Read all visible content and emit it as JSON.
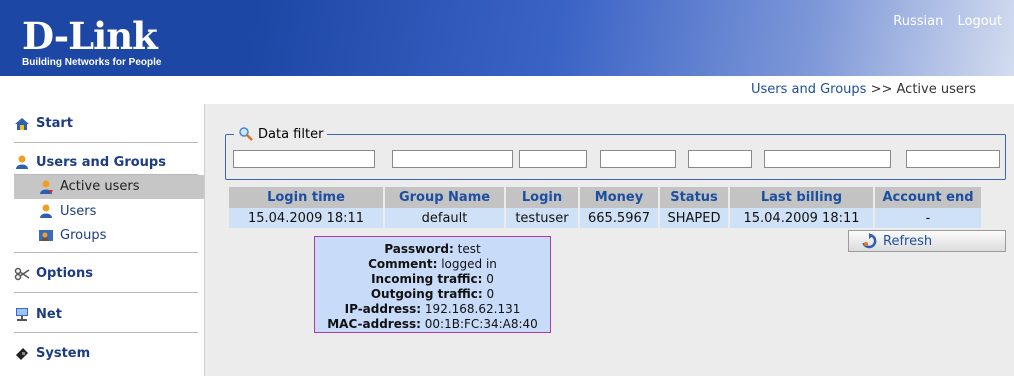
{
  "header": {
    "logo_text": "D-Link",
    "logo_tagline": "Building Networks for People",
    "links": [
      "Russian",
      "Logout"
    ]
  },
  "breadcrumb": {
    "section": "Users and Groups",
    "separator": ">>",
    "page": "Active users"
  },
  "sidebar": {
    "start": "Start",
    "users_groups": "Users and Groups",
    "sub_items": [
      "Active users",
      "Users",
      "Groups"
    ],
    "options": "Options",
    "net": "Net",
    "system": "System"
  },
  "filter": {
    "legend": "Data filter"
  },
  "table": {
    "columns": [
      "Login time",
      "Group Name",
      "Login",
      "Money",
      "Status",
      "Last billing",
      "Account end"
    ],
    "rows": [
      [
        "15.04.2009 18:11",
        "default",
        "testuser",
        "665.5967",
        "SHAPED",
        "15.04.2009 18:11",
        "-"
      ]
    ]
  },
  "refresh_label": "Refresh",
  "tooltip": {
    "password_label": "Password:",
    "password": "test",
    "comment_label": "Comment:",
    "comment": "logged in",
    "incoming_label": "Incoming traffic:",
    "incoming": "0",
    "outgoing_label": "Outgoing traffic:",
    "outgoing": "0",
    "ip_label": "IP-address:",
    "ip": "192.168.62.131",
    "mac_label": "MAC-address:",
    "mac": "00:1B:FC:34:A8:40"
  },
  "colors": {
    "brand_blue": "#1d47a5",
    "link_blue": "#1c4fa0",
    "tooltip_bg": "#c8dcfa",
    "tooltip_border": "#b13aa0",
    "row_bg": "#cfe1f6"
  }
}
